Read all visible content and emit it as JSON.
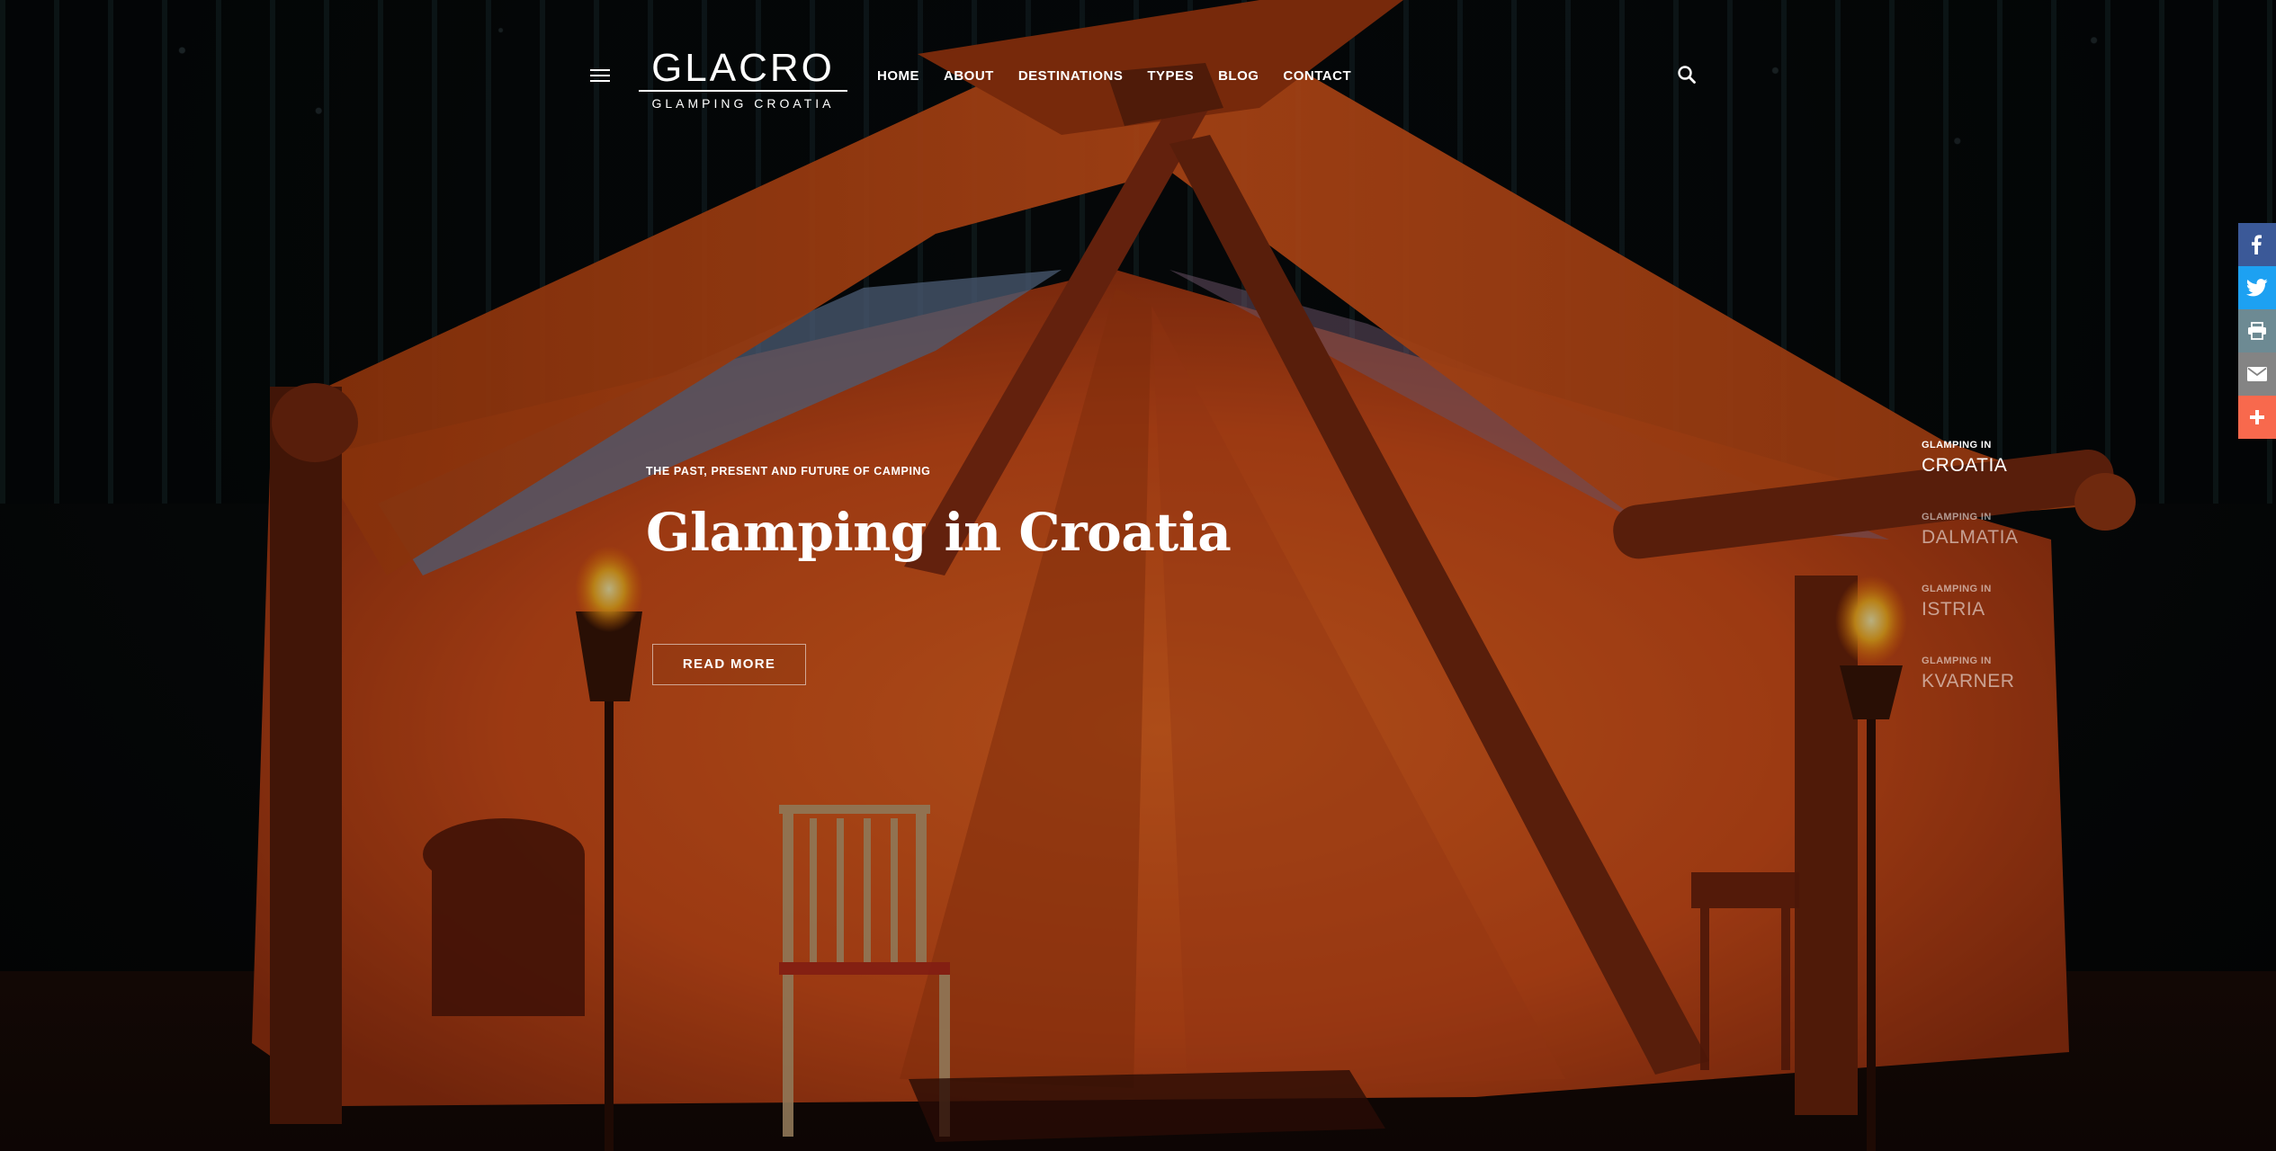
{
  "brand": {
    "logo_word": "GLACRO",
    "logo_sub": "GLAMPING CROATIA"
  },
  "nav": {
    "items": [
      {
        "label": "HOME"
      },
      {
        "label": "ABOUT"
      },
      {
        "label": "DESTINATIONS"
      },
      {
        "label": "TYPES"
      },
      {
        "label": "BLOG"
      },
      {
        "label": "CONTACT"
      }
    ]
  },
  "hero": {
    "kicker": "THE PAST, PRESENT AND FUTURE OF CAMPING",
    "title": "Glamping in Croatia",
    "cta_label": "READ MORE"
  },
  "regions": {
    "items": [
      {
        "prefix": "GLAMPING IN",
        "name": "CROATIA",
        "active": true
      },
      {
        "prefix": "GLAMPING IN",
        "name": "DALMATIA",
        "active": false
      },
      {
        "prefix": "GLAMPING IN",
        "name": "ISTRIA",
        "active": false
      },
      {
        "prefix": "GLAMPING IN",
        "name": "KVARNER",
        "active": false
      }
    ]
  },
  "share": {
    "buttons": [
      {
        "icon": "facebook-icon",
        "color": "#3b5998"
      },
      {
        "icon": "twitter-icon",
        "color": "#1da1f2"
      },
      {
        "icon": "print-icon",
        "color": "#6d8a93"
      },
      {
        "icon": "email-icon",
        "color": "#848484"
      },
      {
        "icon": "plus-icon",
        "color": "#f8694d"
      }
    ]
  },
  "colors": {
    "tent_orange": "#e0501c",
    "tent_shadow": "#8a2a10",
    "pole_wood": "#7a2e14"
  }
}
